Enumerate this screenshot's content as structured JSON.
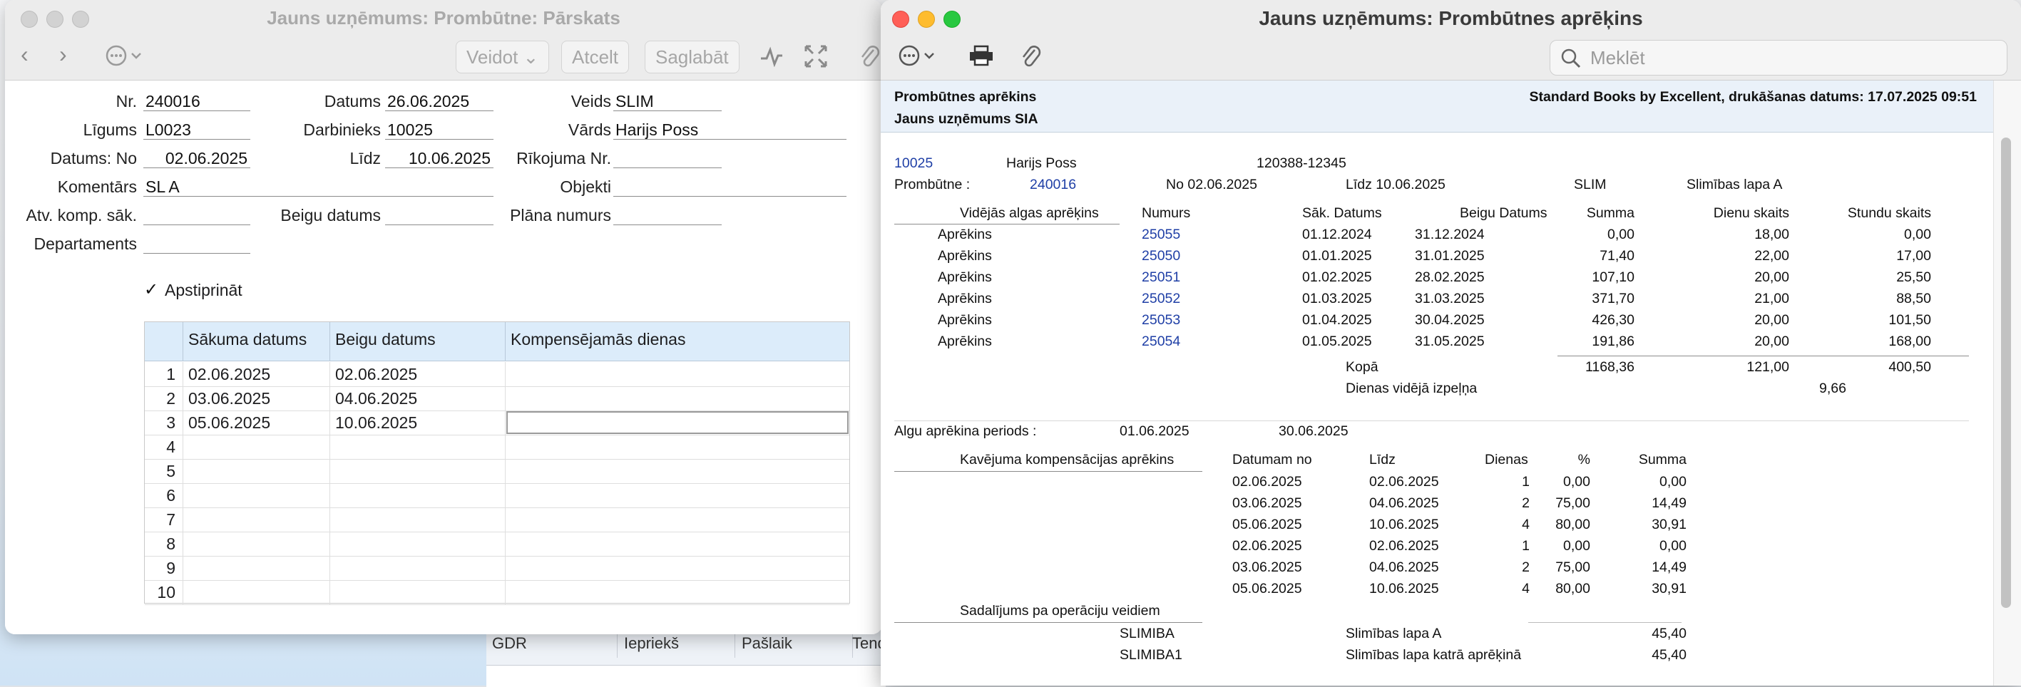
{
  "bg": {
    "cols": [
      "GDR",
      "Iepriekš",
      "Pašlaik",
      "Tend"
    ]
  },
  "w1": {
    "title": "Jauns uzņēmums: Prombūtne: Pārskats",
    "toolbar": {
      "veidot": "Veidot",
      "atcelt": "Atcelt",
      "saglabat": "Saglabāt"
    },
    "labels": {
      "nr": "Nr.",
      "datums": "Datums",
      "veids": "Veids",
      "ligums": "Līgums",
      "darbinieks": "Darbinieks",
      "vards": "Vārds",
      "datums_no": "Datums: No",
      "lidz": "Līdz",
      "rikojuma": "Rīkojuma Nr.",
      "komentars": "Komentārs",
      "objekti": "Objekti",
      "atv": "Atv. komp. sāk.",
      "beigu": "Beigu datums",
      "plana": "Plāna numurs",
      "departaments": "Departaments",
      "apstiprinat": "Apstiprināt"
    },
    "values": {
      "nr": "240016",
      "datums": "26.06.2025",
      "veids": "SLIM",
      "ligums": "L0023",
      "darbinieks": "10025",
      "vards": "Harijs Poss",
      "datums_no": "02.06.2025",
      "lidz": "10.06.2025",
      "komentars": "SL A"
    },
    "check": "✓",
    "grid": {
      "headers": [
        "Sākuma datums",
        "Beigu datums",
        "Kompensējamās dienas"
      ],
      "rows": [
        {
          "n": "1",
          "start": "02.06.2025",
          "end": "02.06.2025"
        },
        {
          "n": "2",
          "start": "03.06.2025",
          "end": "04.06.2025"
        },
        {
          "n": "3",
          "start": "05.06.2025",
          "end": "10.06.2025"
        },
        {
          "n": "4",
          "start": "",
          "end": ""
        },
        {
          "n": "5",
          "start": "",
          "end": ""
        },
        {
          "n": "6",
          "start": "",
          "end": ""
        },
        {
          "n": "7",
          "start": "",
          "end": ""
        },
        {
          "n": "8",
          "start": "",
          "end": ""
        },
        {
          "n": "9",
          "start": "",
          "end": ""
        },
        {
          "n": "10",
          "start": "",
          "end": ""
        }
      ]
    }
  },
  "w2": {
    "title": "Jauns uzņēmums: Prombūtnes aprēķins",
    "search_placeholder": "Meklēt",
    "report": {
      "h_title": "Prombūtnes aprēkins",
      "h_company": "Jauns uzņēmums SIA",
      "h_right": "Standard Books by Excellent, drukāšanas datums: 17.07.2025 09:51",
      "emp_code": "10025",
      "emp_name": "Harijs Poss",
      "emp_id": "120388-12345",
      "absence_label": "Prombūtne :",
      "absence_nr": "240016",
      "no": "No 02.06.2025",
      "lidz": "Līdz 10.06.2025",
      "type": "SLIM",
      "type_desc": "Slimības lapa A",
      "avg_header": {
        "title": "Vidējās algas aprēķins",
        "numurs": "Numurs",
        "sak": "Sāk. Datums",
        "beigu": "Beigu Datums",
        "summa": "Summa",
        "dienu": "Dienu skaits",
        "stundu": "Stundu skaits"
      },
      "avg_rows": [
        {
          "label": "Aprēkins",
          "nr": "25055",
          "sak": "01.12.2024",
          "beigu": "31.12.2024",
          "summa": "0,00",
          "dienu": "18,00",
          "stundu": "0,00"
        },
        {
          "label": "Aprēkins",
          "nr": "25050",
          "sak": "01.01.2025",
          "beigu": "31.01.2025",
          "summa": "71,40",
          "dienu": "22,00",
          "stundu": "17,00"
        },
        {
          "label": "Aprēkins",
          "nr": "25051",
          "sak": "01.02.2025",
          "beigu": "28.02.2025",
          "summa": "107,10",
          "dienu": "20,00",
          "stundu": "25,50"
        },
        {
          "label": "Aprēkins",
          "nr": "25052",
          "sak": "01.03.2025",
          "beigu": "31.03.2025",
          "summa": "371,70",
          "dienu": "21,00",
          "stundu": "88,50"
        },
        {
          "label": "Aprēkins",
          "nr": "25053",
          "sak": "01.04.2025",
          "beigu": "30.04.2025",
          "summa": "426,30",
          "dienu": "20,00",
          "stundu": "101,50"
        },
        {
          "label": "Aprēkins",
          "nr": "25054",
          "sak": "01.05.2025",
          "beigu": "31.05.2025",
          "summa": "191,86",
          "dienu": "20,00",
          "stundu": "168,00"
        }
      ],
      "kopa": {
        "label": "Kopā",
        "summa": "1168,36",
        "dienu": "121,00",
        "stundu": "400,50"
      },
      "daily": {
        "label": "Dienas vidējā izpeļņa",
        "value": "9,66"
      },
      "period": {
        "label": "Algu aprēkina periods :",
        "from": "01.06.2025",
        "to": "30.06.2025"
      },
      "comp_header": {
        "title": "Kavējuma kompensācijas aprēkins",
        "datumam": "Datumam no",
        "lidz": "Līdz",
        "dienas": "Dienas",
        "pct": "%",
        "summa": "Summa"
      },
      "comp_rows": [
        {
          "from": "02.06.2025",
          "to": "02.06.2025",
          "days": "1",
          "pct": "0,00",
          "sum": "0,00"
        },
        {
          "from": "03.06.2025",
          "to": "04.06.2025",
          "days": "2",
          "pct": "75,00",
          "sum": "14,49"
        },
        {
          "from": "05.06.2025",
          "to": "10.06.2025",
          "days": "4",
          "pct": "80,00",
          "sum": "30,91"
        },
        {
          "from": "02.06.2025",
          "to": "02.06.2025",
          "days": "1",
          "pct": "0,00",
          "sum": "0,00"
        },
        {
          "from": "03.06.2025",
          "to": "04.06.2025",
          "days": "2",
          "pct": "75,00",
          "sum": "14,49"
        },
        {
          "from": "05.06.2025",
          "to": "10.06.2025",
          "days": "4",
          "pct": "80,00",
          "sum": "30,91"
        }
      ],
      "split_title": "Sadalījums pa operāciju veidiem",
      "split_rows": [
        {
          "code": "SLIMIBA",
          "desc": "Slimības lapa A",
          "sum": "45,40"
        },
        {
          "code": "SLIMIBA1",
          "desc": "Slimības lapa katrā aprēķinā",
          "sum": "45,40"
        }
      ]
    }
  }
}
